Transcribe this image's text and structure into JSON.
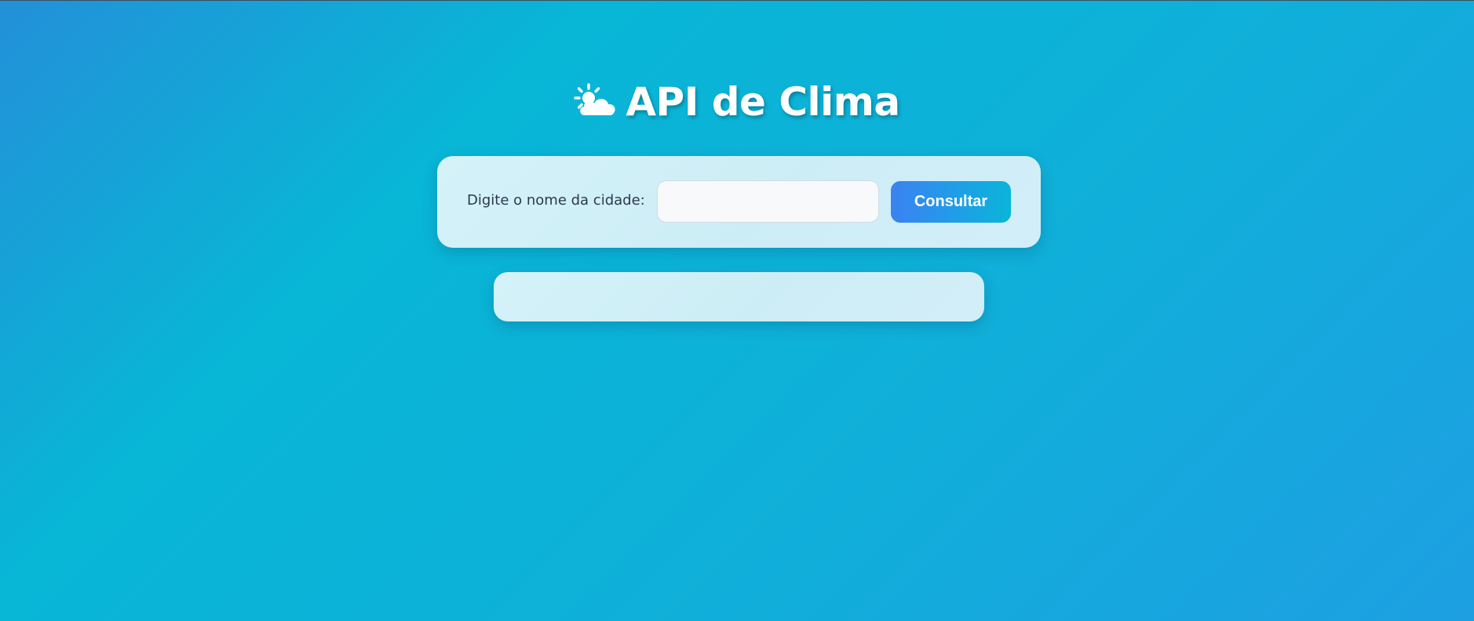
{
  "header": {
    "title": "API de Clima",
    "icon": "sun-behind-cloud-icon"
  },
  "search": {
    "label": "Digite o nome da cidade:",
    "input_value": "",
    "placeholder": "",
    "button_label": "Consultar"
  },
  "result": {
    "content": ""
  },
  "colors": {
    "background_start": "#2390d8",
    "background_mid": "#08b6d6",
    "card_background": "#d0eff7",
    "button_start": "#3b82f0",
    "button_end": "#0ab5d8",
    "title_text": "#ffffff",
    "label_text": "#2c3a4a"
  }
}
